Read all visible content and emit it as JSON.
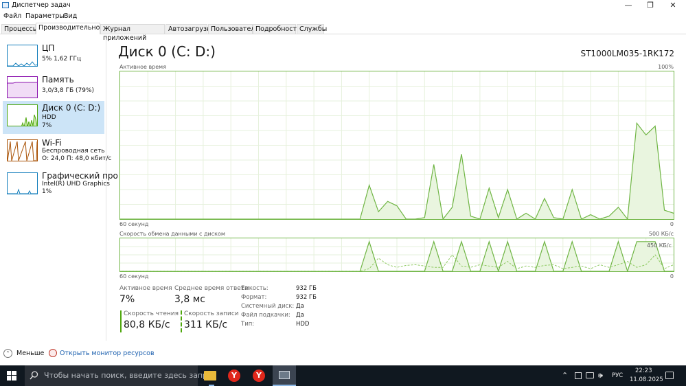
{
  "window": {
    "title": "Диспетчер задач",
    "minimize_glyph": "—",
    "maximize_glyph": "❐",
    "close_glyph": "✕"
  },
  "menu": [
    "Файл",
    "Параметры",
    "Вид"
  ],
  "tabs": [
    "Процессы",
    "Производительность",
    "Журнал приложений",
    "Автозагрузка",
    "Пользователи",
    "Подробности",
    "Службы"
  ],
  "active_tab": "Производительность",
  "sidebar": {
    "items": [
      {
        "title": "ЦП",
        "sub1": "5% 1,62 ГГц",
        "sub2": "",
        "color": "#117dbb"
      },
      {
        "title": "Память",
        "sub1": "3,0/3,8 ГБ (79%)",
        "sub2": "",
        "color": "#8b12ae"
      },
      {
        "title": "Диск 0 (C: D:)",
        "sub1": "HDD",
        "sub2": "7%",
        "color": "#4da60c"
      },
      {
        "title": "Wi-Fi",
        "sub1": "Беспроводная сеть",
        "sub2": "О: 24,0 П: 48,0 кбит/с",
        "color": "#a74f01"
      },
      {
        "title": "Графический про",
        "sub1": "Intel(R) UHD Graphics",
        "sub2": "1%",
        "color": "#117dbb"
      }
    ],
    "selected_index": 2
  },
  "main": {
    "title": "Диск 0 (C: D:)",
    "model": "ST1000LM035-1RK172",
    "chart1": {
      "label": "Активное время",
      "max_label": "100%",
      "time_label": "60 секунд",
      "min_label": "0"
    },
    "chart2": {
      "label": "Скорость обмена данными с диском",
      "max_label": "500 КБ/с",
      "inner_label": "450 КБ/с",
      "time_label": "60 секунд",
      "min_label": "0"
    },
    "stats": {
      "active_time_label": "Активное время",
      "active_time_value": "7%",
      "avg_response_label": "Среднее время ответа",
      "avg_response_value": "3,8 мс",
      "read_speed_label": "Скорость чтения",
      "read_speed_value": "80,8 КБ/с",
      "write_speed_label": "Скорость записи",
      "write_speed_value": "311 КБ/с"
    },
    "properties": [
      {
        "label": "Емкость:",
        "value": "932 ГБ"
      },
      {
        "label": "Формат:",
        "value": "932 ГБ"
      },
      {
        "label": "Системный диск:",
        "value": "Да"
      },
      {
        "label": "Файл подкачки:",
        "value": "Да"
      },
      {
        "label": "Тип:",
        "value": "HDD"
      }
    ]
  },
  "chart_data": [
    {
      "type": "area",
      "label": "Активное время",
      "x_range": [
        60,
        0
      ],
      "ylim": [
        0,
        100
      ],
      "x": [
        60,
        59,
        58,
        57,
        56,
        55,
        54,
        53,
        52,
        51,
        50,
        49,
        48,
        47,
        46,
        45,
        44,
        43,
        42,
        41,
        40,
        39,
        38,
        37,
        36,
        35,
        34,
        33,
        32,
        31,
        30,
        29,
        28,
        27,
        26,
        25,
        24,
        23,
        22,
        21,
        20,
        19,
        18,
        17,
        16,
        15,
        14,
        13,
        12,
        11,
        10,
        9,
        8,
        7,
        6,
        5,
        4,
        3,
        2,
        1,
        0
      ],
      "values": [
        0,
        0,
        0,
        0,
        0,
        0,
        0,
        0,
        0,
        0,
        0,
        0,
        0,
        0,
        0,
        0,
        0,
        0,
        0,
        0,
        0,
        0,
        0,
        0,
        0,
        0,
        0,
        23,
        5,
        12,
        9,
        0,
        0,
        1,
        37,
        0,
        8,
        44,
        2,
        0,
        21,
        1,
        20,
        0,
        4,
        0,
        14,
        1,
        0,
        20,
        0,
        3,
        0,
        2,
        8,
        0,
        65,
        57,
        63,
        6,
        4
      ]
    },
    {
      "type": "line",
      "label": "Скорость обмена данными с диском",
      "x_range": [
        60,
        0
      ],
      "ylim": [
        0,
        500
      ],
      "series": [
        {
          "values": [
            0,
            0,
            0,
            0,
            0,
            0,
            0,
            0,
            0,
            0,
            0,
            0,
            0,
            0,
            0,
            0,
            0,
            0,
            0,
            0,
            0,
            0,
            0,
            0,
            0,
            0,
            0,
            450,
            0,
            0,
            0,
            0,
            0,
            0,
            450,
            0,
            0,
            450,
            0,
            0,
            450,
            0,
            450,
            0,
            0,
            0,
            450,
            0,
            0,
            450,
            0,
            0,
            0,
            0,
            450,
            0,
            450,
            450,
            450,
            0,
            0
          ]
        },
        {
          "values": [
            0,
            0,
            0,
            0,
            0,
            0,
            0,
            0,
            0,
            0,
            0,
            0,
            0,
            0,
            0,
            0,
            0,
            0,
            0,
            0,
            0,
            0,
            0,
            0,
            0,
            0,
            0,
            40,
            200,
            100,
            60,
            90,
            100,
            80,
            60,
            60,
            250,
            80,
            60,
            100,
            80,
            60,
            150,
            40,
            80,
            60,
            90,
            100,
            40,
            60,
            80,
            40,
            100,
            60,
            100,
            150,
            60,
            100,
            250,
            40,
            100
          ]
        }
      ]
    }
  ],
  "footer": {
    "less_label": "Меньше",
    "monitor_label": "Открыть монитор ресурсов"
  },
  "taskbar": {
    "search_placeholder": "Чтобы начать поиск, введите здесь запрос",
    "lang": "РУС",
    "time": "22:23",
    "date": "11.08.2025"
  }
}
